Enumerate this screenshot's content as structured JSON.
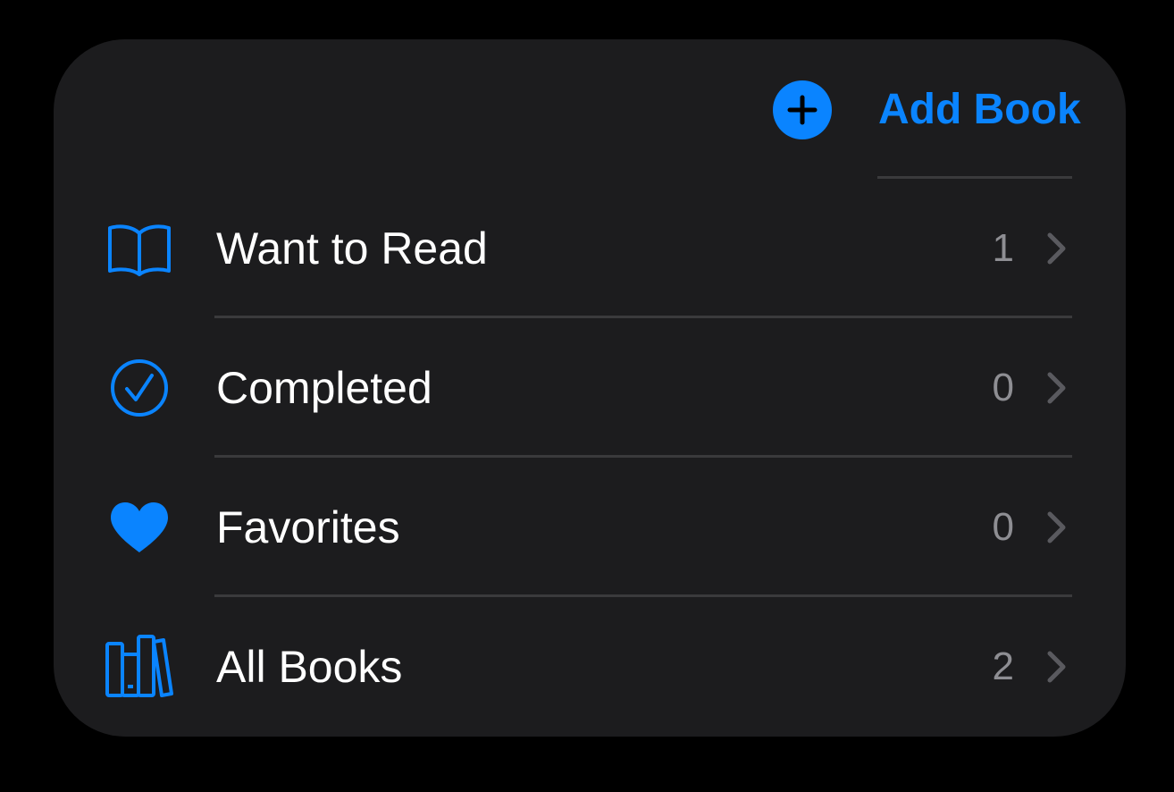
{
  "colors": {
    "accent": "#0a84ff",
    "background": "#000000",
    "card": "#1c1c1e",
    "text_primary": "#ffffff",
    "text_secondary": "#8e8e93",
    "chevron": "#5a5a5f",
    "separator": "#3a3a3c",
    "plus_glyph": "#000000"
  },
  "header": {
    "add_book_label": "Add Book",
    "add_book_icon": "plus-circle-fill-icon"
  },
  "rows": [
    {
      "label": "Want to Read",
      "count": "1",
      "icon": "book-open-icon"
    },
    {
      "label": "Completed",
      "count": "0",
      "icon": "checkmark-circle-icon"
    },
    {
      "label": "Favorites",
      "count": "0",
      "icon": "heart-fill-icon"
    },
    {
      "label": "All Books",
      "count": "2",
      "icon": "books-vertical-icon"
    }
  ]
}
